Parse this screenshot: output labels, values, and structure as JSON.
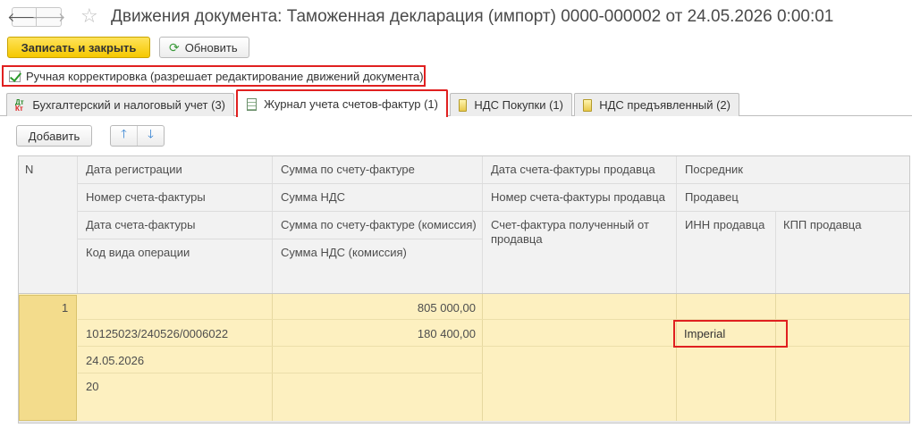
{
  "window": {
    "title": "Движения документа: Таможенная декларация (импорт) 0000-000002 от 24.05.2026 0:00:01",
    "back_glyph": "🡐",
    "forward_glyph": "🡒",
    "star_glyph": "☆"
  },
  "actions": {
    "save_close": "Записать и закрыть",
    "refresh": "Обновить",
    "refresh_icon": "refresh-icon"
  },
  "manual": {
    "label": "Ручная корректировка (разрешает редактирование движений документа)",
    "checked": true
  },
  "tabs": [
    {
      "label": "Бухгалтерский и налоговый учет (3)",
      "icon": "accounting-icon",
      "badge": "ДтКт"
    },
    {
      "label": "Журнал учета счетов-фактур (1)",
      "icon": "journal-grid-icon",
      "active": true
    },
    {
      "label": "НДС Покупки (1)",
      "icon": "register-icon"
    },
    {
      "label": "НДС предъявленный (2)",
      "icon": "register-icon"
    }
  ],
  "toolbar": {
    "add": "Добавить",
    "up_glyph": "🡑",
    "down_glyph": "🡓"
  },
  "table": {
    "col_n": "N",
    "col1": [
      "Дата регистрации",
      "Номер счета-фактуры",
      "Дата счета-фактуры",
      "Код вида операции"
    ],
    "col2": [
      "Сумма по счету-фактуре",
      "Сумма НДС",
      "Сумма по счету-фактуре (комиссия)",
      "Сумма НДС (комиссия)"
    ],
    "col3": [
      "Дата счета-фактуры продавца",
      "Номер счета-фактуры продавца",
      "Счет-фактура полученный от продавца"
    ],
    "col4": [
      "Посредник",
      "Продавец",
      "ИНН продавца",
      "КПП продавца"
    ],
    "rows": [
      {
        "n": "1",
        "reg_date": "",
        "invoice_no": "10125023/240526/0006022",
        "invoice_date": "24.05.2026",
        "op_code": "20",
        "amount": "805 000,00",
        "vat": "180 400,00",
        "seller": "Imperial"
      }
    ]
  },
  "colors": {
    "accent_yellow": "#f5c800",
    "highlight_red": "#e02020",
    "row_bg": "#fdf0c0"
  }
}
